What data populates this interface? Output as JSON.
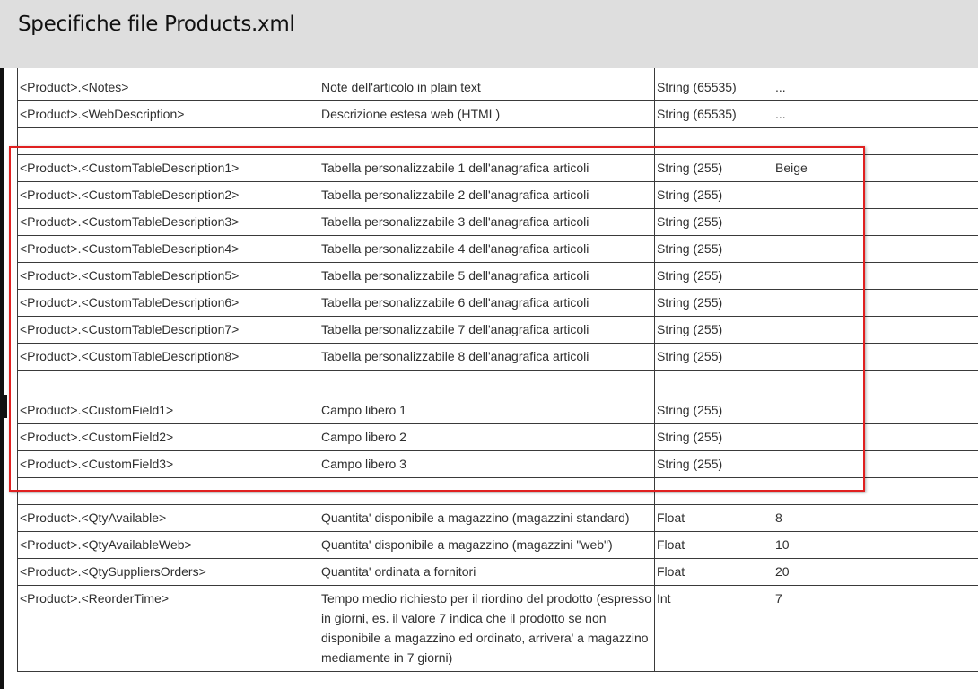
{
  "title": "Specifiche file Products.xml",
  "rows": [
    {
      "field": "",
      "desc": "",
      "type": "",
      "example": ""
    },
    {
      "field": "<Product>.<Notes>",
      "desc": "Note dell'articolo in plain text",
      "type": "String (65535)",
      "example": "..."
    },
    {
      "field": "<Product>.<WebDescription>",
      "desc": "Descrizione estesa web (HTML)",
      "type": "String (65535)",
      "example": "..."
    },
    {
      "field": "",
      "desc": "",
      "type": "",
      "example": ""
    },
    {
      "field": "<Product>.<CustomTableDescription1>",
      "desc": "Tabella personalizzabile 1 dell'anagrafica articoli",
      "type": "String (255)",
      "example": "Beige"
    },
    {
      "field": "<Product>.<CustomTableDescription2>",
      "desc": "Tabella personalizzabile 2 dell'anagrafica articoli",
      "type": "String (255)",
      "example": ""
    },
    {
      "field": "<Product>.<CustomTableDescription3>",
      "desc": "Tabella personalizzabile 3 dell'anagrafica articoli",
      "type": "String (255)",
      "example": ""
    },
    {
      "field": "<Product>.<CustomTableDescription4>",
      "desc": "Tabella personalizzabile 4 dell'anagrafica articoli",
      "type": "String (255)",
      "example": ""
    },
    {
      "field": "<Product>.<CustomTableDescription5>",
      "desc": "Tabella personalizzabile 5 dell'anagrafica articoli",
      "type": "String (255)",
      "example": ""
    },
    {
      "field": "<Product>.<CustomTableDescription6>",
      "desc": "Tabella personalizzabile 6 dell'anagrafica articoli",
      "type": "String (255)",
      "example": ""
    },
    {
      "field": "<Product>.<CustomTableDescription7>",
      "desc": "Tabella personalizzabile 7 dell'anagrafica articoli",
      "type": "String (255)",
      "example": ""
    },
    {
      "field": "<Product>.<CustomTableDescription8>",
      "desc": "Tabella personalizzabile 8 dell'anagrafica articoli",
      "type": "String (255)",
      "example": ""
    },
    {
      "field": "",
      "desc": "",
      "type": "",
      "example": ""
    },
    {
      "field": "<Product>.<CustomField1>",
      "desc": "Campo libero 1",
      "type": "String (255)",
      "example": ""
    },
    {
      "field": "<Product>.<CustomField2>",
      "desc": "Campo libero 2",
      "type": "String (255)",
      "example": ""
    },
    {
      "field": "<Product>.<CustomField3>",
      "desc": "Campo libero 3",
      "type": "String (255)",
      "example": ""
    },
    {
      "field": "",
      "desc": "",
      "type": "",
      "example": ""
    },
    {
      "field": "<Product>.<QtyAvailable>",
      "desc": "Quantita' disponibile a magazzino (magazzini standard)",
      "type": "Float",
      "example": "8"
    },
    {
      "field": "<Product>.<QtyAvailableWeb>",
      "desc": "Quantita' disponibile a magazzino (magazzini \"web\")",
      "type": "Float",
      "example": "10"
    },
    {
      "field": "<Product>.<QtySuppliersOrders>",
      "desc": "Quantita' ordinata a fornitori",
      "type": "Float",
      "example": "20"
    },
    {
      "field": "<Product>.<ReorderTime>",
      "desc": "Tempo medio richiesto per il riordino del prodotto (espresso in giorni, es. il valore 7 indica che il prodotto se non disponibile a magazzino ed ordinato, arrivera' a magazzino mediamente in 7 giorni)",
      "type": "Int",
      "example": "7"
    }
  ],
  "colors": {
    "header_bg": "#dedede",
    "highlight_border": "#e02020"
  }
}
